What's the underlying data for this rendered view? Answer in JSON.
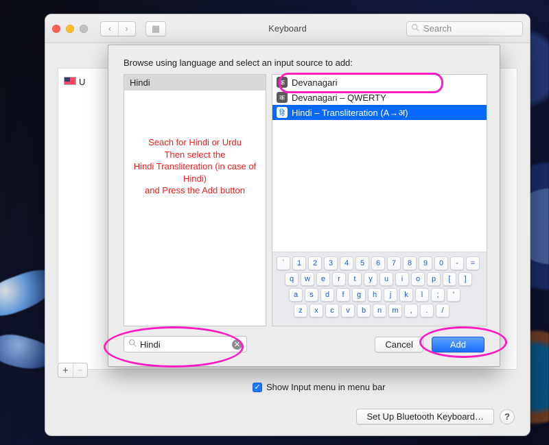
{
  "titlebar": {
    "title": "Keyboard",
    "search_placeholder": "Search"
  },
  "background_pane": {
    "visible_source_label_fragment": "U",
    "add_btn": "+",
    "remove_btn": "−"
  },
  "footer": {
    "setup_bt_label": "Set Up Bluetooth Keyboard…",
    "help_label": "?"
  },
  "sheet": {
    "heading": "Browse using language and select an input source to add:",
    "search_value": "Hindi",
    "language_list": [
      {
        "name": "Hindi",
        "selected": true
      }
    ],
    "source_list": [
      {
        "icon": "क",
        "label": "Devanagari",
        "selected": false,
        "name": "devanagari"
      },
      {
        "icon": "क",
        "label": "Devanagari – QWERTY",
        "selected": false,
        "name": "devanagari-qwerty"
      },
      {
        "icon": "हि",
        "label": "Hindi – Transliteration (A→अ)",
        "selected": true,
        "name": "hindi-transliteration"
      }
    ],
    "instructions": "Seach for Hindi or Urdu\nThen select the\nHindi Transliteration (in case of\nHindi)\nand Press the Add button",
    "cancel_label": "Cancel",
    "add_label": "Add",
    "show_menu_label": "Show Input menu in menu bar",
    "show_menu_checked": true,
    "keyboard_rows": [
      [
        "`",
        "1",
        "2",
        "3",
        "4",
        "5",
        "6",
        "7",
        "8",
        "9",
        "0",
        "-",
        "="
      ],
      [
        "q",
        "w",
        "e",
        "r",
        "t",
        "y",
        "u",
        "i",
        "o",
        "p",
        "[",
        "]"
      ],
      [
        "a",
        "s",
        "d",
        "f",
        "g",
        "h",
        "j",
        "k",
        "l",
        ";",
        "'"
      ],
      [
        "z",
        "x",
        "c",
        "v",
        "b",
        "n",
        "m",
        ",",
        ".",
        "/"
      ]
    ]
  }
}
